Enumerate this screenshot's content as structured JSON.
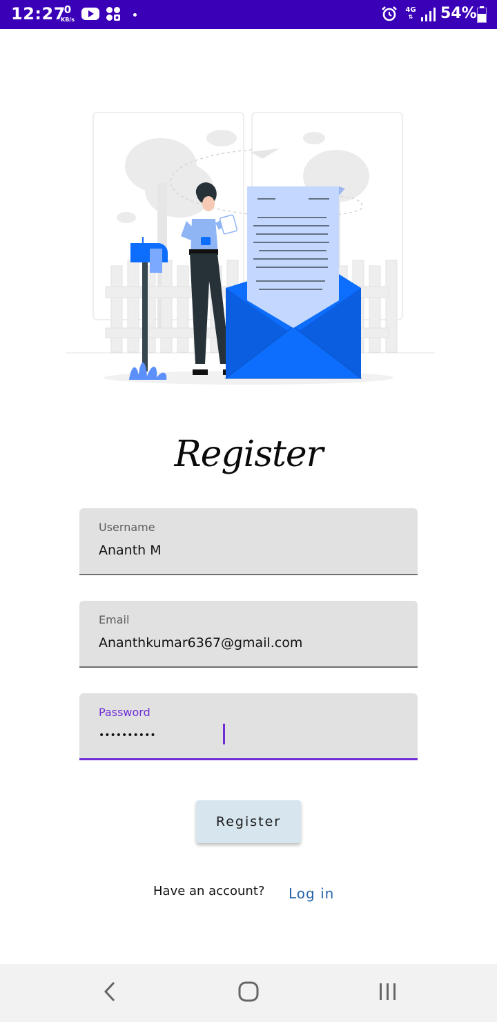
{
  "status_bar": {
    "time": "12:27",
    "speed_value": "0",
    "speed_unit": "KB/s",
    "network": "4G",
    "battery": "54%",
    "icons": [
      "youtube-icon",
      "app-icon",
      "dot-icon",
      "alarm-icon",
      "network-4g-icon",
      "signal-icon",
      "battery-icon"
    ]
  },
  "illustration": {
    "name": "register-illustration"
  },
  "page": {
    "title": "Register"
  },
  "form": {
    "username": {
      "label": "Username",
      "value": "Ananth M"
    },
    "email": {
      "label": "Email",
      "value": "Ananthkumar6367@gmail.com"
    },
    "password": {
      "label": "Password",
      "value": "••••••••••"
    },
    "submit_label": "Register"
  },
  "footer": {
    "prompt": "Have an account?",
    "login_label": "Log in"
  },
  "navigation": {
    "icons": [
      "back-icon",
      "home-icon",
      "recents-icon"
    ]
  },
  "colors": {
    "status_bar": "#3a00b8",
    "accent": "#6f2bd6",
    "field_bg": "#e1e1e1",
    "button_bg": "#d6e5ee",
    "link": "#2563a8",
    "illustration_blue": "#0d6efd"
  }
}
